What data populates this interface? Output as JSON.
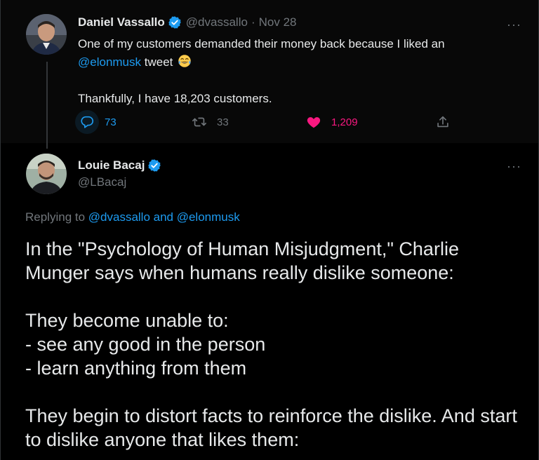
{
  "parent_tweet": {
    "name": "Daniel Vassallo",
    "handle": "@dvassallo",
    "separator": "·",
    "date": "Nov 28",
    "text_line1": "One of my customers demanded their money back because I liked an",
    "mention": "@elonmusk",
    "text_line2_rest": " tweet",
    "text_line3": "Thankfully, I have 18,203 customers.",
    "replies": "73",
    "retweets": "33",
    "likes": "1,209",
    "more": "···"
  },
  "main_tweet": {
    "name": "Louie Bacaj",
    "handle": "@LBacaj",
    "more": "···",
    "replying_prefix": "Replying to ",
    "replying_to": "@dvassallo and @elonmusk",
    "paragraphs": [
      "In the \"Psychology of Human Misjudgment,\" Charlie Munger says when humans really dislike someone:",
      "They become unable to:",
      "- see any good in the person",
      "- learn anything from them",
      "They begin to distort facts to reinforce the dislike. And start to dislike anyone that likes them:"
    ]
  },
  "colors": {
    "background": "#000000",
    "text": "#e7e9ea",
    "secondary": "#71767b",
    "accent": "#1d9bf0",
    "like": "#f91880"
  },
  "icons": {
    "verified": "verified-badge-icon",
    "reply": "reply-bubble-icon",
    "retweet": "retweet-icon",
    "like": "heart-icon",
    "share": "share-icon",
    "emoji": "tears-of-joy-emoji"
  }
}
